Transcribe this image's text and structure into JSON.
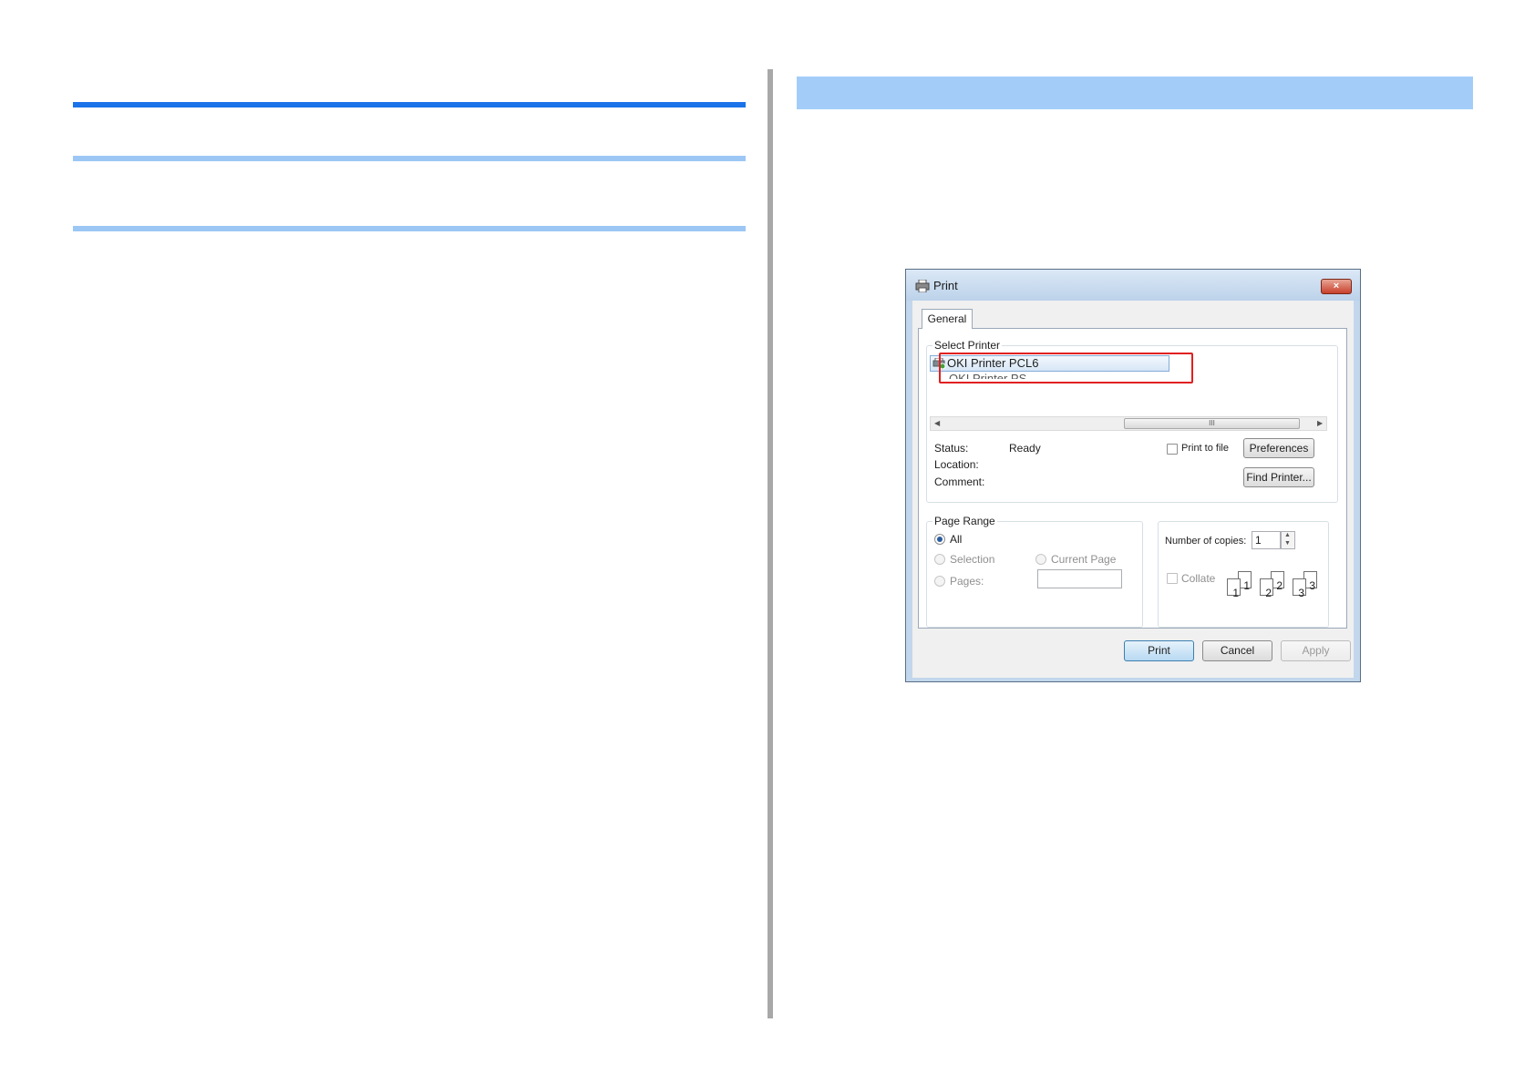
{
  "dialog": {
    "title": "Print",
    "close_label": "×",
    "tab_general": "General",
    "select_printer": {
      "group_label": "Select Printer",
      "printers": [
        "OKI Printer PCL6",
        "OKI Printer PS"
      ],
      "selected": "OKI Printer PCL6",
      "scroll_thumb": "III"
    },
    "status": {
      "status_label": "Status:",
      "status_value": "Ready",
      "location_label": "Location:",
      "location_value": "",
      "comment_label": "Comment:",
      "comment_value": ""
    },
    "print_to_file_label": "Print to file",
    "preferences_button": "Preferences",
    "find_printer_button": "Find Printer...",
    "page_range": {
      "group_label": "Page Range",
      "all_label": "All",
      "selection_label": "Selection",
      "current_page_label": "Current Page",
      "pages_label": "Pages:",
      "pages_value": "",
      "selected_option": "All"
    },
    "copies": {
      "label": "Number of copies:",
      "value": "1",
      "collate_label": "Collate",
      "collate_checked": false,
      "page_icons": [
        "1",
        "1",
        "2",
        "2",
        "3",
        "3"
      ]
    },
    "buttons": {
      "print": "Print",
      "cancel": "Cancel",
      "apply": "Apply"
    }
  },
  "colors": {
    "heading_rule": "#1a73e8",
    "subheading_rule": "#9cc7f5",
    "section_band": "#a3cdf8",
    "highlight": "#e02020"
  }
}
